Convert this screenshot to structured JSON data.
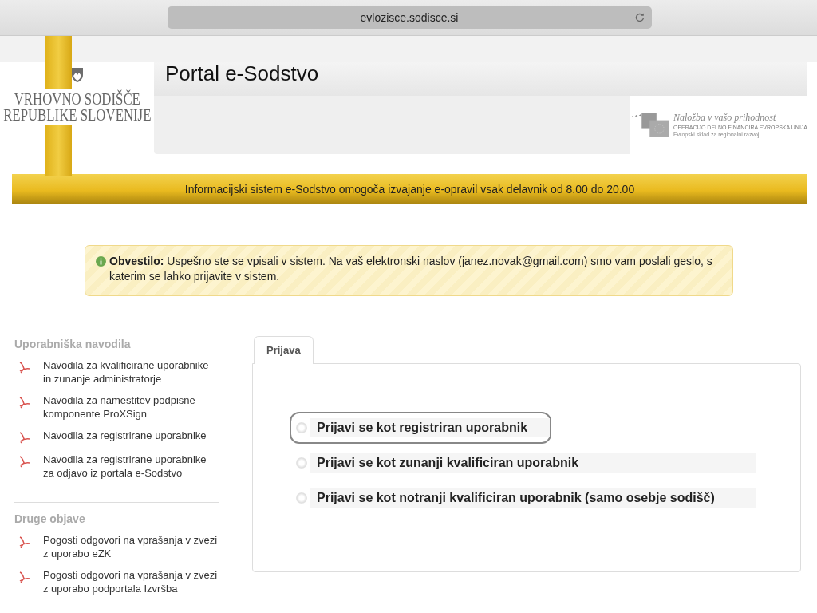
{
  "browser": {
    "url": "evlozisce.sodisce.si"
  },
  "header": {
    "title": "Portal e-Sodstvo",
    "logo_lines": [
      "VRHOVNO SODIŠČE",
      "REPUBLIKE SLOVENIJE"
    ],
    "eu_logo": {
      "slogan": "Naložba v vašo prihodnost",
      "line_1": "OPERACIJO DELNO FINANCIRA EVROPSKA UNIJA",
      "line_2": "Evropski sklad za regionalni razvoj"
    },
    "banner": "Informacijski sistem e-Sodstvo omogoča izvajanje e-opravil vsak delavnik od 8.00 do 20.00"
  },
  "notice": {
    "label": "Obvestilo:",
    "text": "Uspešno ste se vpisali v sistem. Na vaš elektronski naslov (janez.novak@gmail.com) smo vam poslali geslo, s katerim se lahko prijavite v sistem."
  },
  "sidebar": [
    {
      "heading": "Uporabniška navodila",
      "items": [
        "Navodila za kvalificirane uporabnike in zunanje administratorje",
        "Navodila za namestitev podpisne komponente ProXSign",
        "Navodila za registrirane uporabnike",
        "Navodila za registrirane uporabnike za odjavo iz portala e-Sodstvo"
      ]
    },
    {
      "heading": "Druge objave",
      "items": [
        "Pogosti odgovori na vprašanja v zvezi z uporabo eZK",
        "Pogosti odgovori na vprašanja v zvezi z uporabo podportala Izvršba"
      ]
    }
  ],
  "tabs": [
    {
      "label": "Prijava",
      "selected": true
    }
  ],
  "login_options": [
    {
      "label": "Prijavi se kot registriran uporabnik",
      "selected": false,
      "focused": true
    },
    {
      "label": "Prijavi se kot zunanji kvalificiran uporabnik",
      "selected": false,
      "focused": false
    },
    {
      "label": "Prijavi se kot notranji kvalificiran uporabnik (samo osebje sodišč)",
      "selected": false,
      "focused": false
    }
  ]
}
